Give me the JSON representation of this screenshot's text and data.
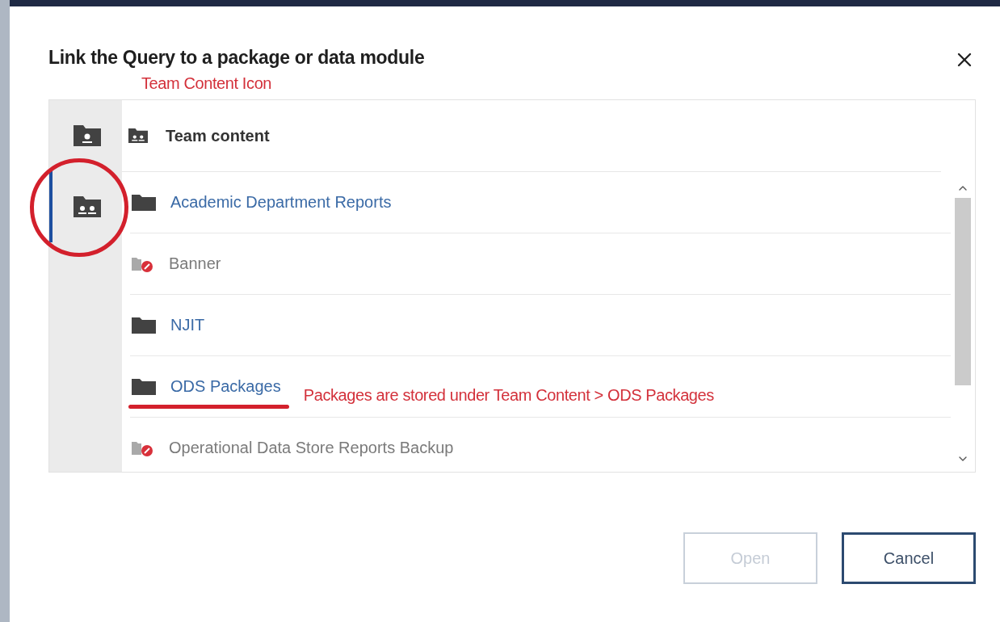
{
  "dialog": {
    "title": "Link the Query to a package or data module",
    "annotation": "Team Content Icon"
  },
  "rail": [
    {
      "kind": "my-content",
      "selected": false,
      "circled": false
    },
    {
      "kind": "team-content",
      "selected": true,
      "circled": true
    }
  ],
  "header": {
    "title": "Team content"
  },
  "items": [
    {
      "name": "Academic Department Reports",
      "available": true,
      "underlined": false
    },
    {
      "name": "Banner",
      "available": false,
      "underlined": false
    },
    {
      "name": "NJIT",
      "available": true,
      "underlined": false
    },
    {
      "name": "ODS Packages",
      "available": true,
      "underlined": true,
      "annotation": "Packages are stored under Team Content > ODS Packages"
    },
    {
      "name": "Operational Data Store Reports Backup",
      "available": false,
      "underlined": false
    }
  ],
  "buttons": [
    {
      "label": "Open",
      "disabled": true
    },
    {
      "label": "Cancel",
      "disabled": false
    }
  ]
}
